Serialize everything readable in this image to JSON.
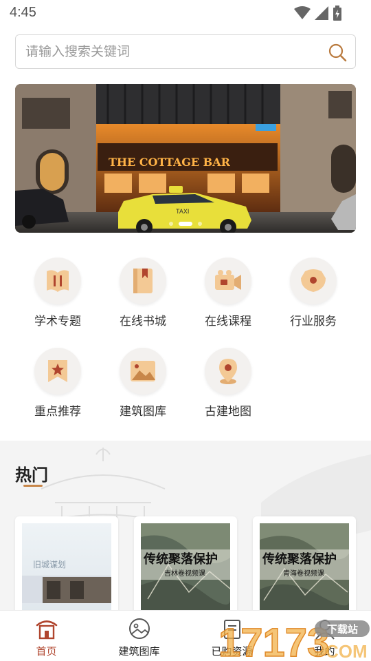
{
  "status_bar": {
    "time": "4:45"
  },
  "search": {
    "placeholder": "请输入搜索关键词"
  },
  "banner": {
    "sign_text": "THE COTTAGE BAR",
    "taxi_text": "TAXI",
    "slides": 3,
    "active_slide": 2
  },
  "categories": [
    {
      "label": "学术专题",
      "icon": "book-icon"
    },
    {
      "label": "在线书城",
      "icon": "bookmark-book-icon"
    },
    {
      "label": "在线课程",
      "icon": "video-camera-icon"
    },
    {
      "label": "行业服务",
      "icon": "service-icon"
    },
    {
      "label": "重点推荐",
      "icon": "star-badge-icon"
    },
    {
      "label": "建筑图库",
      "icon": "image-gallery-icon"
    },
    {
      "label": "古建地图",
      "icon": "map-pin-icon"
    }
  ],
  "hot": {
    "title": "热门",
    "cards": [
      {
        "title": "旧城谋划"
      },
      {
        "title": "传统聚落保护",
        "subtitle": "吉林卷视频课"
      },
      {
        "title": "传统聚落保护",
        "subtitle": "青海卷视频课"
      }
    ]
  },
  "nav": [
    {
      "label": "首页",
      "icon": "home-icon",
      "active": true
    },
    {
      "label": "建筑图库",
      "icon": "gallery-icon",
      "active": false
    },
    {
      "label": "已购资源",
      "icon": "purchased-icon",
      "active": false
    },
    {
      "label": "我的",
      "icon": "profile-icon",
      "active": false
    }
  ],
  "watermark": {
    "text": "17173",
    "badge": "下载站",
    "domain": "COM"
  },
  "colors": {
    "accent": "#b0452e",
    "icon_base": "#f0c79a",
    "icon_deep": "#c8874a",
    "underline": "#c8874a"
  }
}
